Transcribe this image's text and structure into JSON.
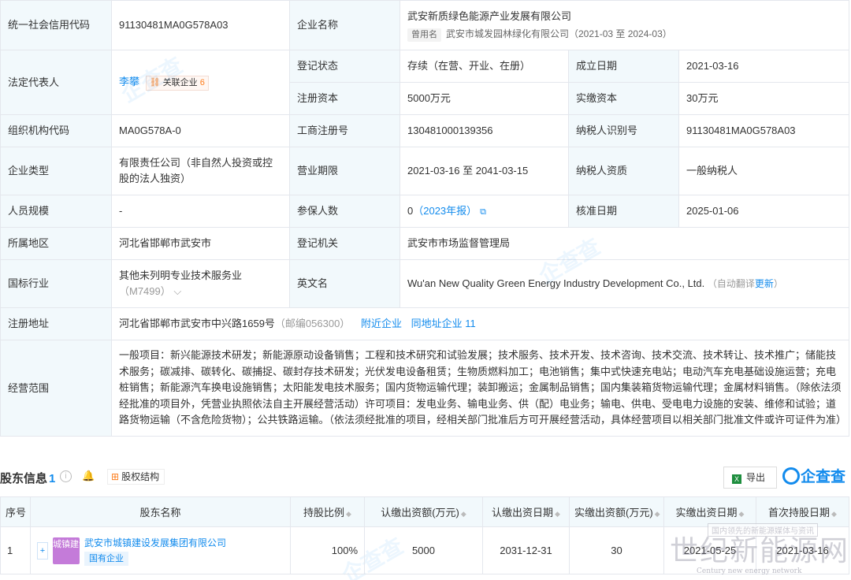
{
  "info": {
    "credit_code_label": "统一社会信用代码",
    "credit_code": "91130481MA0G578A03",
    "company_name_label": "企业名称",
    "company_name": "武安新质绿色能源产业发展有限公司",
    "former_name_tag": "曾用名",
    "former_name": "武安市城发园林绿化有限公司（2021-03 至 2024-03）",
    "legal_rep_label": "法定代表人",
    "legal_rep": "李攀",
    "related_label": "关联企业",
    "related_count": "6",
    "reg_status_label": "登记状态",
    "reg_status": "存续（在营、开业、在册）",
    "est_date_label": "成立日期",
    "est_date": "2021-03-16",
    "reg_capital_label": "注册资本",
    "reg_capital": "5000万元",
    "paid_capital_label": "实缴资本",
    "paid_capital": "30万元",
    "org_code_label": "组织机构代码",
    "org_code": "MA0G578A-0",
    "biz_reg_no_label": "工商注册号",
    "biz_reg_no": "130481000139356",
    "taxpayer_id_label": "纳税人识别号",
    "taxpayer_id": "91130481MA0G578A03",
    "company_type_label": "企业类型",
    "company_type": "有限责任公司（非自然人投资或控股的法人独资）",
    "biz_term_label": "营业期限",
    "biz_term": "2021-03-16 至 2041-03-15",
    "taxpayer_qual_label": "纳税人资质",
    "taxpayer_qual": "一般纳税人",
    "staff_size_label": "人员规模",
    "staff_size": "-",
    "insured_label": "参保人数",
    "insured_count": "0",
    "insured_year": "（2023年报）",
    "approval_date_label": "核准日期",
    "approval_date": "2025-01-06",
    "region_label": "所属地区",
    "region": "河北省邯郸市武安市",
    "reg_authority_label": "登记机关",
    "reg_authority": "武安市市场监督管理局",
    "industry_label": "国标行业",
    "industry": "其他未列明专业技术服务业",
    "industry_code": "（M7499）",
    "english_name_label": "英文名",
    "english_name": "Wu'an New Quality Green Energy Industry Development Co., Ltd.",
    "auto_translate": "（自动翻译",
    "update_link": "更新",
    "auto_translate_end": "）",
    "address_label": "注册地址",
    "address": "河北省邯郸市武安市中兴路1659号",
    "postcode": "（邮编056300）",
    "nearby_link": "附近企业",
    "same_addr_link": "同地址企业",
    "same_addr_count": "11",
    "scope_label": "经营范围",
    "scope": "一般项目：新兴能源技术研发；新能源原动设备销售；工程和技术研究和试验发展；技术服务、技术开发、技术咨询、技术交流、技术转让、技术推广；储能技术服务；碳减排、碳转化、碳捕捉、碳封存技术研发；光伏发电设备租赁；生物质燃料加工；电池销售；集中式快速充电站；电动汽车充电基础设施运营；充电桩销售；新能源汽车换电设施销售；太阳能发电技术服务；国内货物运输代理；装卸搬运；金属制品销售；国内集装箱货物运输代理；金属材料销售。（除依法须经批准的项目外，凭营业执照依法自主开展经营活动）许可项目：发电业务、输电业务、供（配）电业务；输电、供电、受电电力设施的安装、维修和试验；道路货物运输（不含危险货物）；公共铁路运输。（依法须经批准的项目，经相关部门批准后方可开展经营活动，具体经营项目以相关部门批准文件或许可证件为准）"
  },
  "shareholders": {
    "title": "股东信息",
    "count": "1",
    "equity_btn": "股权结构",
    "export_btn": "导出",
    "brand": "企查查",
    "columns": [
      "序号",
      "股东名称",
      "持股比例",
      "认缴出资额(万元)",
      "认缴出资日期",
      "实缴出资额(万元)",
      "实缴出资日期",
      "首次持股日期"
    ],
    "rows": [
      {
        "index": "1",
        "logo_text": "城镇建设",
        "name": "武安市城镇建设发展集团有限公司",
        "tag": "国有企业",
        "ratio": "100%",
        "subscribed": "5000",
        "subscribed_date": "2031-12-31",
        "paid": "30",
        "paid_date": "2021-05-25",
        "first_date": "2021-03-16"
      }
    ]
  },
  "watermark": {
    "site_cn": "世纪新能源网",
    "site_en": "Century new energy network",
    "site_tag": "国内领先的新能源媒体与资讯"
  }
}
